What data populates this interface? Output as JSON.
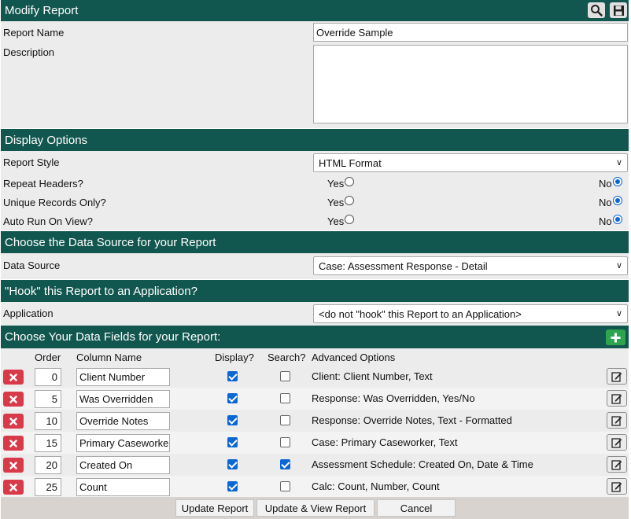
{
  "header": {
    "title": "Modify Report"
  },
  "report_name": {
    "label": "Report Name",
    "value": "Override Sample"
  },
  "description": {
    "label": "Description",
    "value": ""
  },
  "display_options": {
    "title": "Display Options",
    "report_style": {
      "label": "Report Style",
      "value": "HTML Format"
    },
    "yes_label": "Yes",
    "no_label": "No",
    "repeat_headers": {
      "label": "Repeat Headers?",
      "selected": "No"
    },
    "unique_records": {
      "label": "Unique Records Only?",
      "selected": "No"
    },
    "auto_run": {
      "label": "Auto Run On View?",
      "selected": "No"
    }
  },
  "data_source": {
    "title": "Choose the Data Source for your Report",
    "label": "Data Source",
    "value": "Case: Assessment Response - Detail"
  },
  "hook": {
    "title": "\"Hook\" this Report to an Application?",
    "label": "Application",
    "value": "<do not \"hook\" this Report to an Application>"
  },
  "fields": {
    "title": "Choose Your Data Fields for your Report:",
    "columns": {
      "order": "Order",
      "column_name": "Column Name",
      "display": "Display?",
      "search": "Search?",
      "advanced": "Advanced Options"
    },
    "rows": [
      {
        "order": "0",
        "name": "Client Number",
        "display": true,
        "search": false,
        "advanced": "Client: Client Number, Text"
      },
      {
        "order": "5",
        "name": "Was Overridden",
        "display": true,
        "search": false,
        "advanced": "Response: Was Overridden, Yes/No"
      },
      {
        "order": "10",
        "name": "Override Notes",
        "display": true,
        "search": false,
        "advanced": "Response: Override Notes, Text - Formatted"
      },
      {
        "order": "15",
        "name": "Primary Caseworker",
        "display": true,
        "search": false,
        "advanced": "Case: Primary Caseworker, Text"
      },
      {
        "order": "20",
        "name": "Created On",
        "display": true,
        "search": true,
        "advanced": "Assessment Schedule: Created On, Date & Time"
      },
      {
        "order": "25",
        "name": "Count",
        "display": true,
        "search": false,
        "advanced": "Calc: Count, Number, Count"
      }
    ]
  },
  "buttons": {
    "update": "Update Report",
    "update_view": "Update & View Report",
    "cancel": "Cancel"
  },
  "colors": {
    "header_bg": "#12574f",
    "delete_red": "#d93a4a",
    "add_green": "#2ea44f",
    "accent_blue": "#0b66d6"
  },
  "icons": [
    "search-icon",
    "save-icon",
    "add-icon",
    "delete-icon",
    "edit-icon",
    "chevron-down-icon"
  ]
}
